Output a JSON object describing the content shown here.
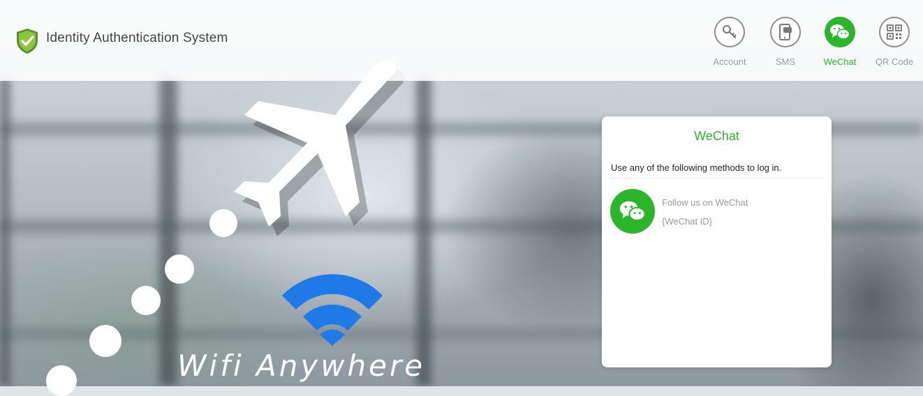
{
  "header": {
    "title": "Identity Authentication System",
    "logo_icon": "shield-check-icon"
  },
  "nav": {
    "items": [
      {
        "label": "Account",
        "icon": "key-icon",
        "active": false
      },
      {
        "label": "SMS",
        "icon": "phone-message-icon",
        "active": false
      },
      {
        "label": "WeChat",
        "icon": "wechat-icon",
        "active": true
      },
      {
        "label": "QR Code",
        "icon": "qr-code-icon",
        "active": false
      }
    ]
  },
  "banner": {
    "text": "Wifi Anywhere",
    "icons": [
      "airplane-icon",
      "wifi-icon"
    ]
  },
  "card": {
    "title": "WeChat",
    "description": "Use any of the following methods to log in.",
    "option": {
      "icon": "wechat-icon",
      "line1": "Follow us on WeChat",
      "line2": "{WeChat ID}"
    }
  },
  "colors": {
    "accent": "#2bb52b",
    "wifi_blue": "#1f7ae8",
    "muted_text": "#9a9a9a"
  }
}
